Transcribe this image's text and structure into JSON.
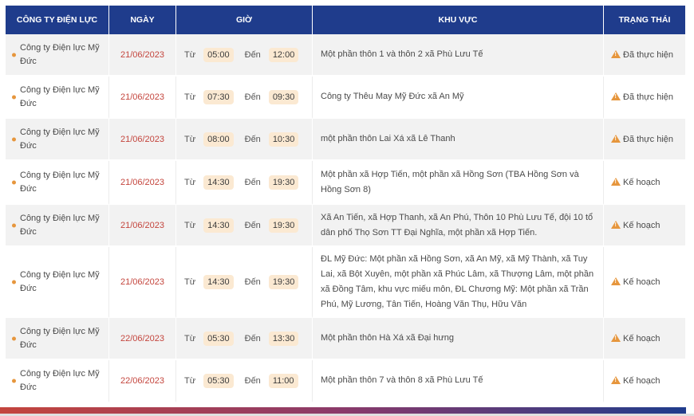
{
  "table": {
    "headers": {
      "company": "CÔNG TY ĐIỆN LỰC",
      "date": "NGÀY",
      "time": "GIỜ",
      "area": "KHU VỰC",
      "status": "TRẠNG THÁI"
    },
    "labels": {
      "from": "Từ",
      "to": "Đến"
    },
    "rows": [
      {
        "company": "Công ty Điện lực Mỹ Đức",
        "date": "21/06/2023",
        "from": "05:00",
        "to": "12:00",
        "area": "Một phần thôn 1 và thôn 2 xã Phù Lưu Tế",
        "status": "Đã thực hiện"
      },
      {
        "company": "Công ty Điện lực Mỹ Đức",
        "date": "21/06/2023",
        "from": "07:30",
        "to": "09:30",
        "area": "Công ty Thêu May Mỹ Đức xã An Mỹ",
        "status": "Đã thực hiện"
      },
      {
        "company": "Công ty Điện lực Mỹ Đức",
        "date": "21/06/2023",
        "from": "08:00",
        "to": "10:30",
        "area": "một phần thôn Lai Xá xã Lê Thanh",
        "status": "Đã thực hiện"
      },
      {
        "company": "Công ty Điện lực Mỹ Đức",
        "date": "21/06/2023",
        "from": "14:30",
        "to": "19:30",
        "area": "Một phần xã Hợp Tiến, một phần xã Hồng Sơn (TBA Hồng Sơn và Hồng Sơn 8)",
        "status": "Kế hoạch"
      },
      {
        "company": "Công ty Điện lực Mỹ Đức",
        "date": "21/06/2023",
        "from": "14:30",
        "to": "19:30",
        "area": "Xã An Tiến, xã Hợp Thanh, xã An Phú, Thôn 10 Phù Lưu Tế, đội 10 tổ dân phố Thọ Sơn TT Đại Nghĩa, một phần xã Hợp Tiến.",
        "status": "Kế hoạch"
      },
      {
        "company": "Công ty Điện lực Mỹ Đức",
        "date": "21/06/2023",
        "from": "14:30",
        "to": "19:30",
        "area": "ĐL Mỹ Đức: Một phần xã Hồng Sơn, xã An Mỹ, xã Mỹ Thành, xã Tuy Lai, xã Bột Xuyên, một phần xã Phúc Lâm, xã Thượng Lâm, một phần xã Đồng Tâm, khu vực miếu môn, ĐL Chương Mỹ: Một phần xã Trần Phú, Mỹ Lương, Tân Tiến, Hoàng Văn Thụ, Hữu Văn",
        "status": "Kế hoạch"
      },
      {
        "company": "Công ty Điện lực Mỹ Đức",
        "date": "22/06/2023",
        "from": "05:30",
        "to": "13:30",
        "area": "Một phần thôn Hà Xá xã Đại hưng",
        "status": "Kế hoạch"
      },
      {
        "company": "Công ty Điện lực Mỹ Đức",
        "date": "22/06/2023",
        "from": "05:30",
        "to": "11:00",
        "area": "Một phần thôn 7 và thôn 8 xã Phù Lưu Tế",
        "status": "Kế hoạch"
      }
    ]
  },
  "colors": {
    "header_bg": "#1f3c8c",
    "date_text": "#c4453d",
    "time_chip": "#fbe9d2",
    "warning_icon": "#e6963d"
  },
  "icons": {
    "status": "warning-icon",
    "row_bullet": "bullet-dot-icon"
  }
}
